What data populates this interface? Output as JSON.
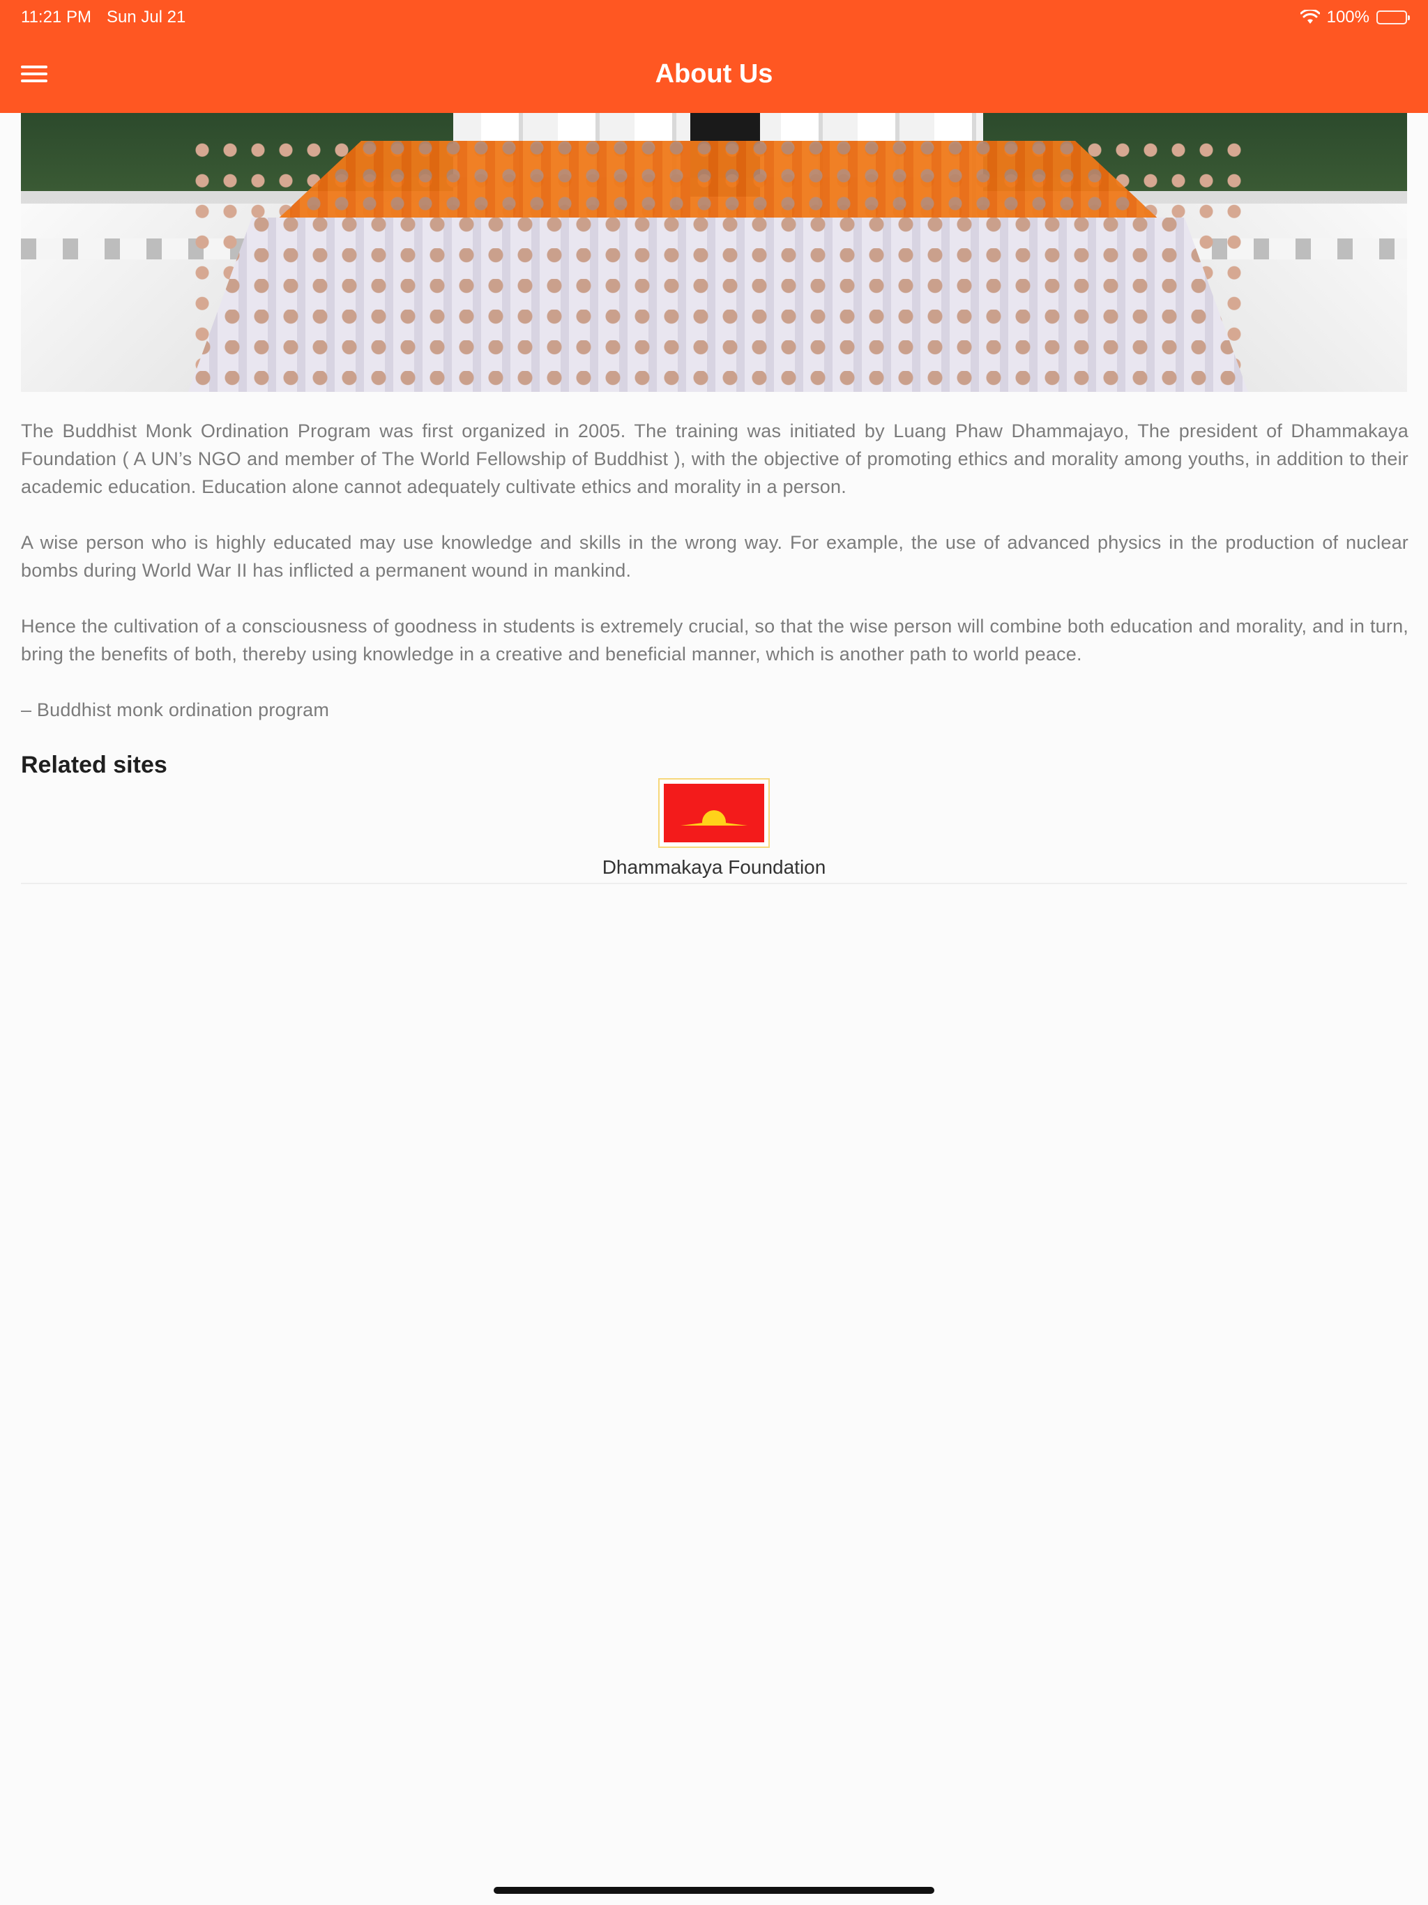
{
  "status_bar": {
    "time": "11:21 PM",
    "date": "Sun Jul 21",
    "battery_percent": "100%"
  },
  "nav": {
    "title": "About Us",
    "menu_icon": "hamburger-menu-icon"
  },
  "colors": {
    "header": "#ff5722",
    "background": "#fbfbfb",
    "body_text": "#7b7b7b",
    "heading_text": "#1f1f1f"
  },
  "content": {
    "paragraphs": [
      "The Buddhist Monk Ordination Program was first organized in 2005. The training was initiated by Luang Phaw Dhammajayo, The president of Dhammakaya Foundation ( A UN’s NGO and member of The World Fellowship of Buddhist ), with the objective of promoting ethics and morality among youths, in addition to their academic education. Education alone cannot adequately cultivate ethics and morality in a person.",
      "A wise person who is highly educated may use knowledge and skills in the wrong way. For example, the use of advanced physics in the production of nuclear bombs during World War II has inflicted a permanent wound in mankind.",
      "Hence the cultivation of a consciousness of goodness in students is extremely crucial, so that the wise person will combine both education and morality, and in turn, bring the benefits of both, thereby using knowledge in a creative and beneficial manner, which is another path to world peace."
    ],
    "signature": "– Buddhist monk ordination program"
  },
  "related_sites": {
    "title": "Related sites",
    "items": [
      {
        "label": "Dhammakaya Foundation",
        "icon": "dhammakaya-flag-logo"
      }
    ]
  }
}
